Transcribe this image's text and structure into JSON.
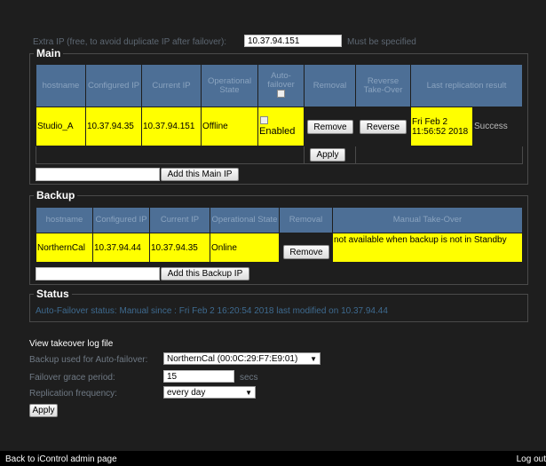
{
  "extra_ip": {
    "label": "Extra IP (free, to avoid duplicate IP after failover):",
    "value": "10.37.94.151",
    "hint": "Must be specified"
  },
  "main": {
    "legend": "Main",
    "headers": [
      "hostname",
      "Configured IP",
      "Current IP",
      "Operational State",
      "Auto-failover",
      "Removal",
      "Reverse Take-Over",
      "Last replication result"
    ],
    "row": {
      "hostname": "Studio_A",
      "configured_ip": "10.37.94.35",
      "current_ip": "10.37.94.151",
      "state": "Offline",
      "auto_failover": "Enabled",
      "remove_label": "Remove",
      "reverse_label": "Reverse",
      "last_time": "Fri Feb 2 11:56:52 2018",
      "last_result": "Success"
    },
    "apply_label": "Apply",
    "add_label": "Add this Main IP",
    "add_value": ""
  },
  "backup": {
    "legend": "Backup",
    "headers": [
      "hostname",
      "Configured IP",
      "Current IP",
      "Operational State",
      "Removal",
      "Manual Take-Over"
    ],
    "row": {
      "hostname": "NorthernCal",
      "configured_ip": "10.37.94.44",
      "current_ip": "10.37.94.35",
      "state": "Online",
      "remove_label": "Remove",
      "takeover": "not available when backup is not in Standby"
    },
    "add_label": "Add this Backup IP",
    "add_value": ""
  },
  "status": {
    "legend": "Status",
    "text": "Auto-Failover status: Manual since : Fri Feb 2 16:20:54 2018 last modified on 10.37.94.44"
  },
  "settings": {
    "log_link": "View takeover log file",
    "backup_label": "Backup used for Auto-failover:",
    "backup_value": "NorthernCal (00:0C:29:F7:E9:01)",
    "grace_label": "Failover grace period:",
    "grace_value": "15",
    "grace_unit": "secs",
    "freq_label": "Replication frequency:",
    "freq_value": "every day",
    "apply_label": "Apply"
  },
  "footer": {
    "back_link": "Back to iControl admin page",
    "logout": "Log out"
  }
}
